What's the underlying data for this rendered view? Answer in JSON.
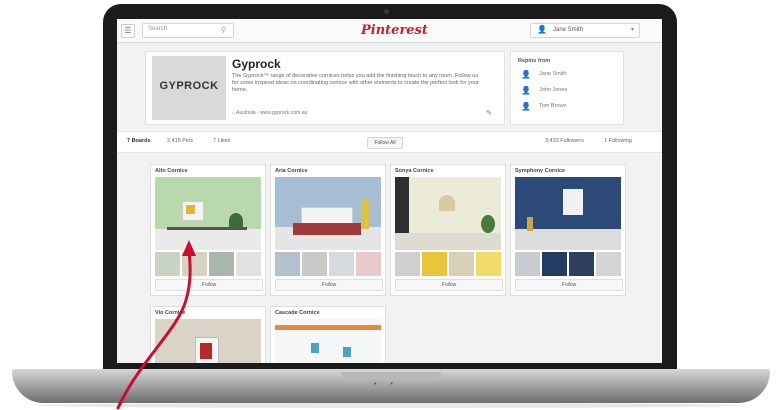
{
  "header": {
    "search_placeholder": "Search",
    "logo": "Pinterest",
    "user_name": "Jane Smith"
  },
  "profile": {
    "logo_text": "GYPROCK",
    "name": "Gyprock",
    "description": "The Gyprock™ range of decorative cornices helps you add the finishing touch to any room. Follow us for some inspired ideas on coordinating cornice with other elements to create the perfect look for your home.",
    "location": "Australia · www.gyprock.com.au"
  },
  "repins": {
    "title": "Repins from",
    "people": [
      "Jane Smith",
      "John Jones",
      "Tom Brown"
    ]
  },
  "tabs": {
    "boards": "7 Boards",
    "pins": "2,415 Pins",
    "likes": "7 Likes",
    "follow_all": "Follow All",
    "followers": "3,433 Followers",
    "following": "1 Following"
  },
  "boards": [
    {
      "title": "Alto Cornice",
      "follow": "Follow"
    },
    {
      "title": "Aria Cornice",
      "follow": "Follow"
    },
    {
      "title": "Sonya Cornice",
      "follow": "Follow"
    },
    {
      "title": "Symphony Cornice",
      "follow": "Follow"
    },
    {
      "title": "Vio Cornice",
      "follow": ""
    },
    {
      "title": "Cascade Cornice",
      "follow": ""
    }
  ],
  "colors": {
    "brand": "#cb2027",
    "arrow": "#c8102e"
  }
}
